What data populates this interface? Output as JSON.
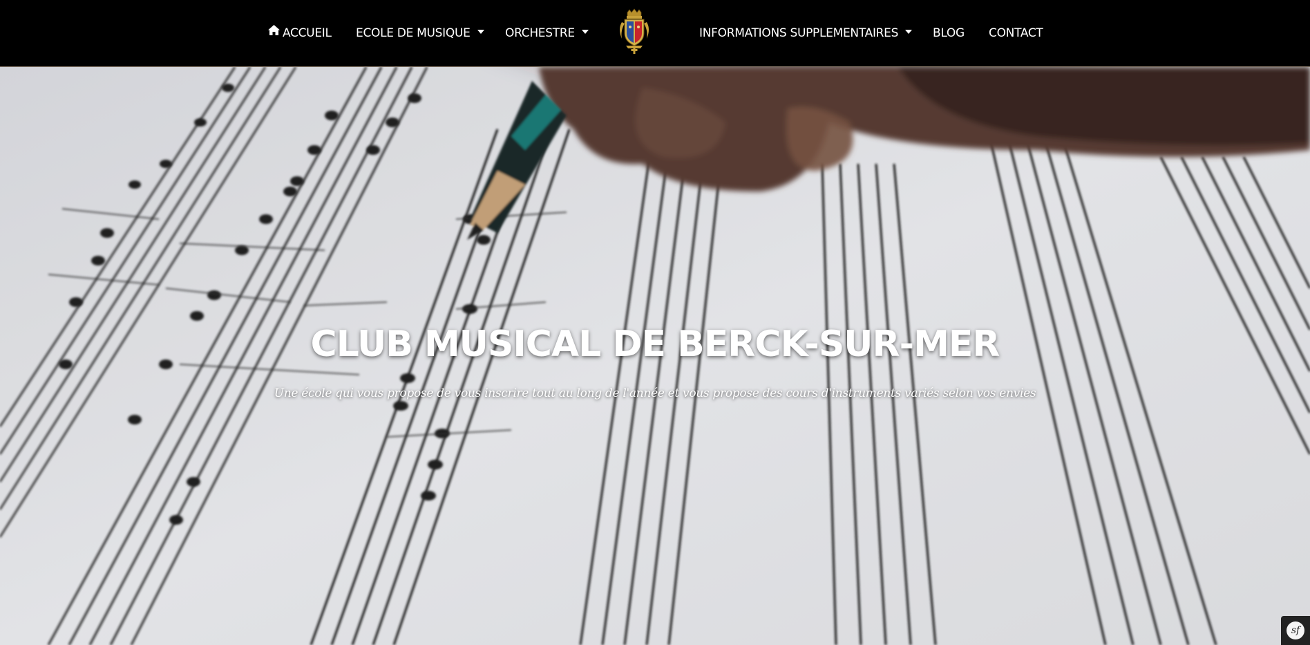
{
  "nav": {
    "home_label": "ACCUEIL",
    "school_label": "ECOLE DE MUSIQUE",
    "orchestra_label": "ORCHESTRE",
    "info_label": "INFORMATIONS SUPPLEMENTAIRES",
    "blog_label": "BLOG",
    "contact_label": "CONTACT"
  },
  "hero": {
    "title": "CLUB MUSICAL DE BERCK-SUR-MER",
    "subtitle": "Une école qui vous propose de vous inscrire tout au long de l'année et vous propose des cours d'instruments variés selon vos envies"
  },
  "debug_toolbar": {
    "label": "sf"
  },
  "icons": {
    "home": "home-icon",
    "logo": "coat-of-arms-logo",
    "dropdown": "caret-down-icon"
  },
  "colors": {
    "navbar_bg": "#000000",
    "nav_text": "#ffffff",
    "hero_text": "#ffffff",
    "paper": "#e6e7ea"
  }
}
